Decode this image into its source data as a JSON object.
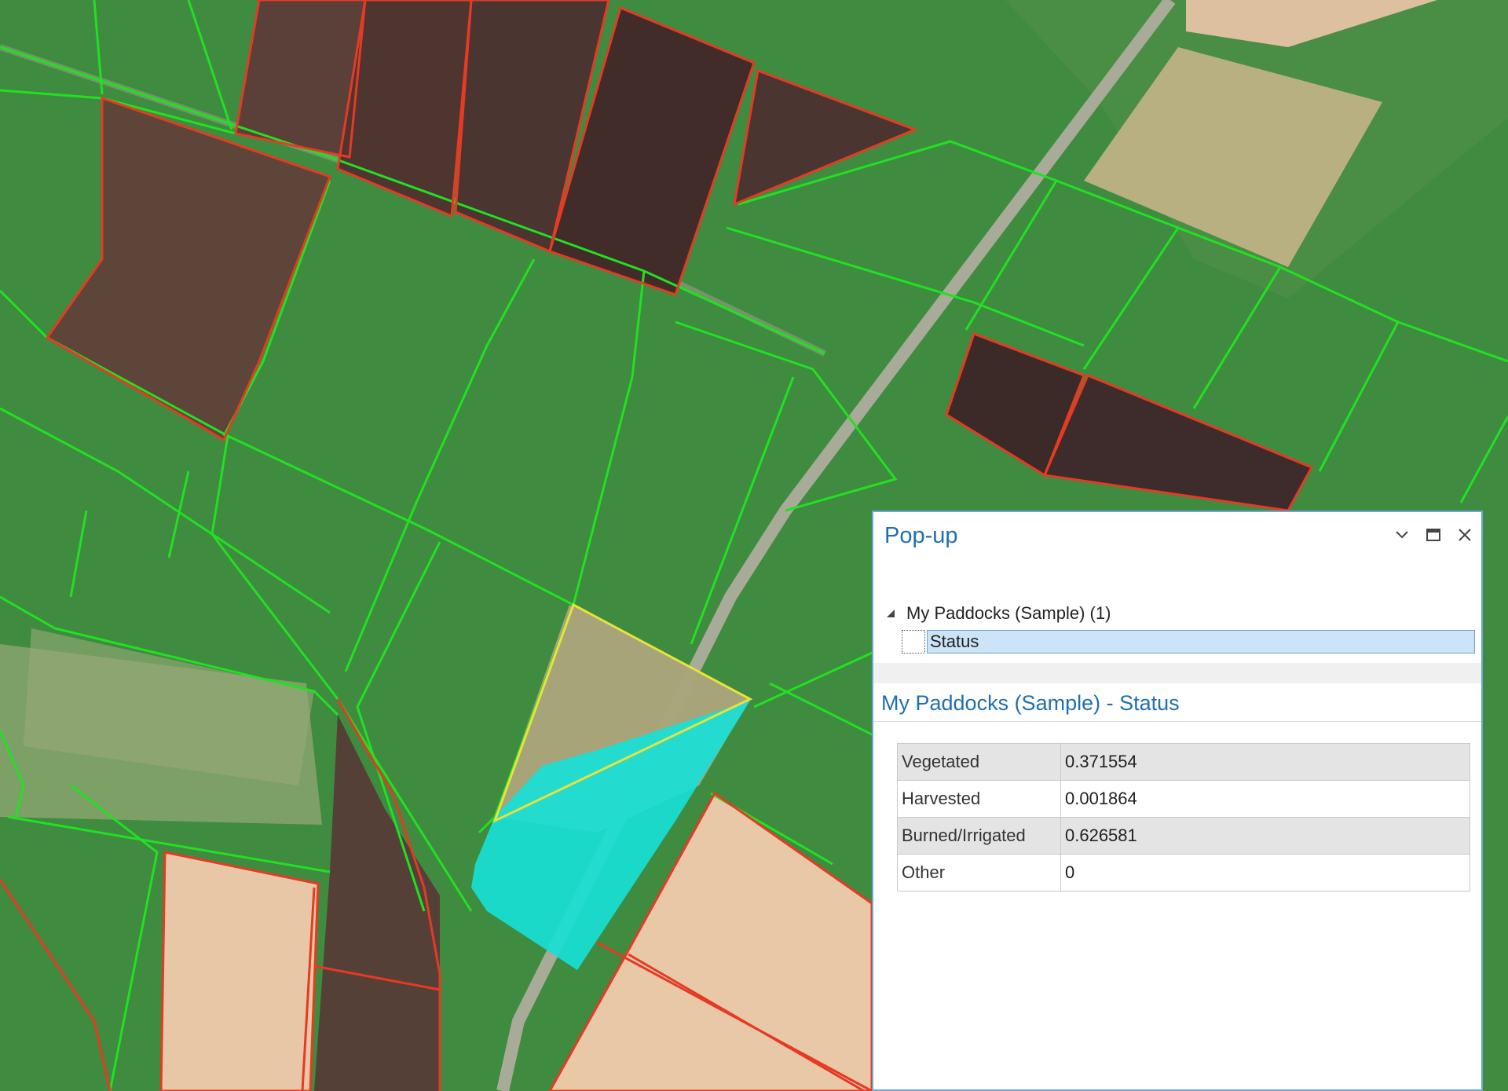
{
  "map": {
    "colors": {
      "paddock_outline": "#22e022",
      "harvested_outline": "#e53a24",
      "selection_outline": "#e8e23a",
      "selected_fill": "#18dfd5"
    }
  },
  "popup": {
    "title": "Pop-up",
    "icons": [
      "chevron-down-icon",
      "maximize-icon",
      "close-icon"
    ],
    "layer_node": "My Paddocks (Sample) (1)",
    "feature_label": "Status",
    "section_title": "My Paddocks (Sample) - Status",
    "attributes": [
      {
        "key": "Vegetated",
        "value": "0.371554"
      },
      {
        "key": "Harvested",
        "value": "0.001864"
      },
      {
        "key": "Burned/Irrigated",
        "value": "0.626581"
      },
      {
        "key": "Other",
        "value": "0"
      }
    ]
  }
}
